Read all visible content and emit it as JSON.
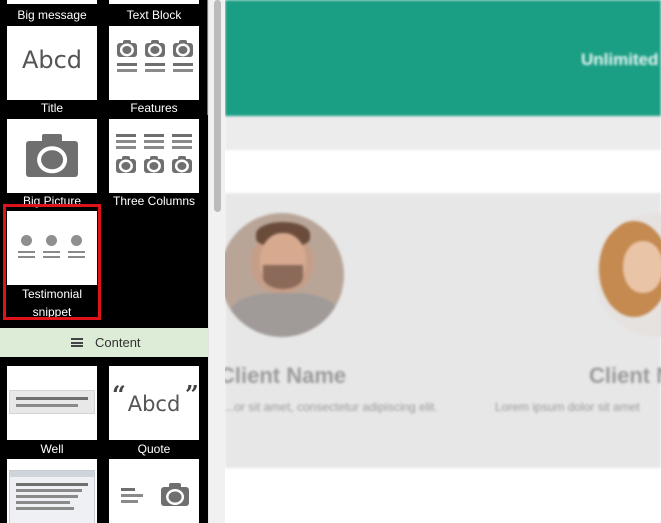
{
  "sidebar": {
    "snippets": [
      {
        "label": "Big message"
      },
      {
        "label": "Text Block"
      },
      {
        "label": "Title",
        "sample": "Abcd"
      },
      {
        "label": "Features"
      },
      {
        "label": "Big Picture"
      },
      {
        "label": "Three Columns"
      },
      {
        "label_line1": "Testimonial",
        "label_line2": "snippet",
        "selected": true
      },
      {
        "label": "Well"
      },
      {
        "label": "Quote",
        "sample": "Abcd",
        "open_quote": "“",
        "close_quote": "”"
      }
    ],
    "section_header": {
      "label": "Content",
      "icon": "list-icon"
    },
    "selection_color": "#e0131a",
    "section_color": "#dcecd6"
  },
  "preview": {
    "hero_text": "Unlimited",
    "hero_color": "#1a9e84",
    "testimonials": [
      {
        "name": "Client Name",
        "text": "...or sit amet, consectetur adipiscing elit."
      },
      {
        "name": "Client N",
        "text": "Lorem ipsum dolor sit amet"
      }
    ]
  }
}
